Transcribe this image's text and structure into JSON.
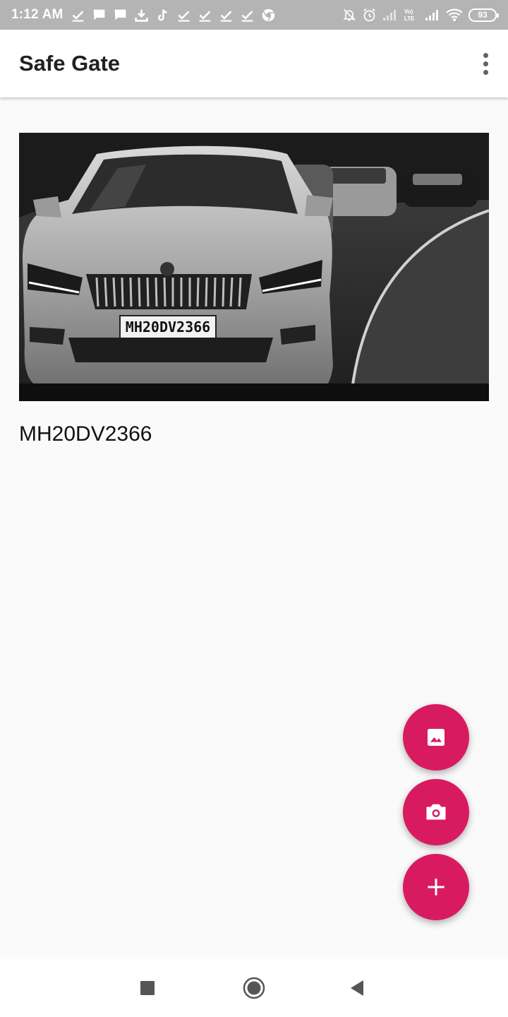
{
  "status_bar": {
    "time": "1:12 AM",
    "battery": "93"
  },
  "app_bar": {
    "title": "Safe Gate"
  },
  "vehicle": {
    "plate_number": "MH20DV2366"
  },
  "colors": {
    "accent": "#d81b60",
    "status_bar": "#b4b4b4",
    "background": "#fafafa"
  },
  "icons": {
    "gallery": "image-icon",
    "camera": "camera-icon",
    "add": "plus-icon"
  }
}
